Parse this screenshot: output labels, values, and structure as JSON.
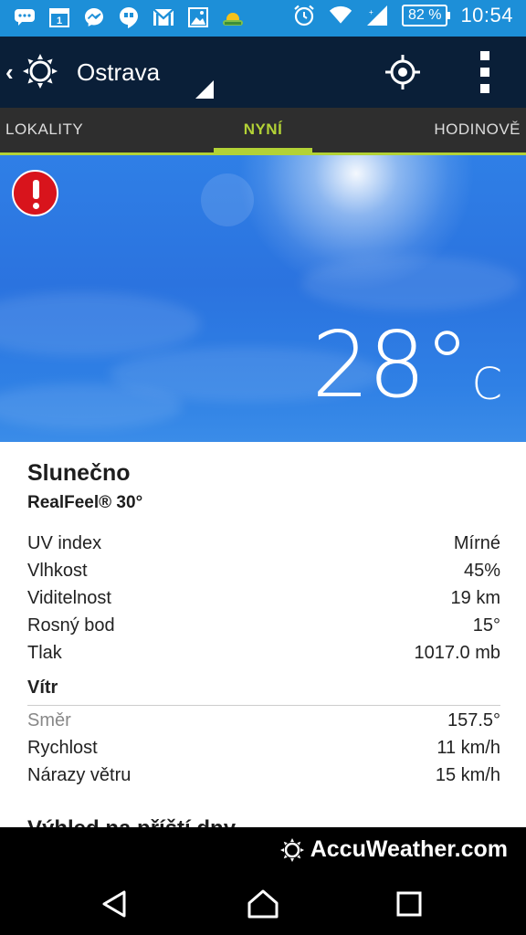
{
  "status_bar": {
    "icons": [
      "chat-notification-icon",
      "calendar-icon",
      "messenger-icon",
      "hangouts-icon",
      "gmail-icon",
      "gallery-icon",
      "weather-notification-icon"
    ],
    "alarm_icon": "alarm-clock-icon",
    "wifi_icon": "wifi-icon",
    "signal_icon": "signal-icon",
    "battery": "82 %",
    "time": "10:54",
    "calendar_day": "1"
  },
  "app_bar": {
    "city": "Ostrava",
    "locate_icon": "gps-locate-icon",
    "menu_icon": "overflow-menu-icon"
  },
  "tabs": [
    {
      "label": "LOKALITY",
      "active": false
    },
    {
      "label": "NYNÍ",
      "active": true
    },
    {
      "label": "HODINOVĚ",
      "active": false
    }
  ],
  "current": {
    "temperature": "28°",
    "unit": "C",
    "alert_icon": "alert-exclamation-icon",
    "condition": "Slunečno",
    "realfeel": "RealFeel® 30°"
  },
  "details": [
    {
      "label": "UV index",
      "value": "Mírné"
    },
    {
      "label": "Vlhkost",
      "value": "45%"
    },
    {
      "label": "Viditelnost",
      "value": "19 km"
    },
    {
      "label": "Rosný bod",
      "value": "15°"
    },
    {
      "label": "Tlak",
      "value": "1017.0 mb"
    }
  ],
  "wind": {
    "heading": "Vítr",
    "rows": [
      {
        "label": "Směr",
        "value": "157.5°"
      },
      {
        "label": "Rychlost",
        "value": "11 km/h"
      },
      {
        "label": "Nárazy větru",
        "value": "15 km/h"
      }
    ]
  },
  "outlook_heading": "Výhled na příští dny",
  "brand": "AccuWeather.com",
  "colors": {
    "status_bar": "#1d8fd8",
    "app_bar": "#0a1f38",
    "tab_bar": "#2e2e2e",
    "accent": "#b3d236",
    "sky": "#2b73df",
    "alert": "#d8141c"
  }
}
